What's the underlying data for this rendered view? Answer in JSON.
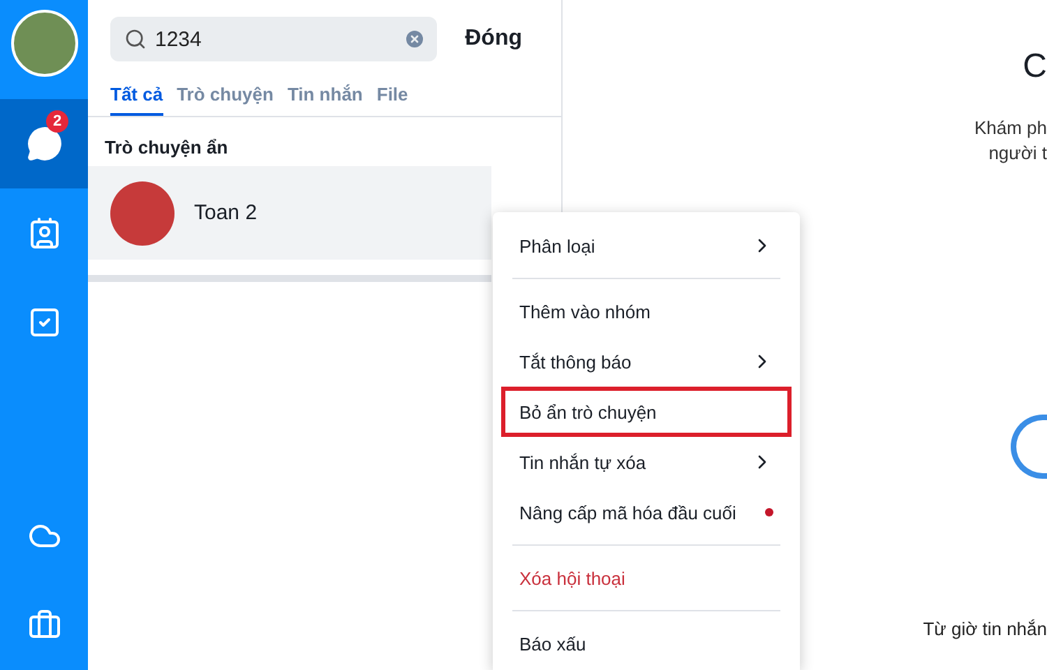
{
  "rail": {
    "top": [
      {
        "kind": "chat",
        "selected": true,
        "badge": "2"
      },
      {
        "kind": "contacts",
        "selected": false
      },
      {
        "kind": "todo",
        "selected": false
      }
    ],
    "bottom": [
      {
        "kind": "cloud",
        "selected": false
      },
      {
        "kind": "briefcase",
        "selected": false
      }
    ]
  },
  "search": {
    "value": "1234"
  },
  "close_button": "Đóng",
  "tabs": [
    {
      "label": "Tất cả",
      "selected": true
    },
    {
      "label": "Trò chuyện",
      "selected": false
    },
    {
      "label": "Tin nhắn",
      "selected": false
    },
    {
      "label": "File",
      "selected": false
    }
  ],
  "section_title": "Trò chuyện ẩn",
  "results": [
    {
      "name": "Toan 2",
      "selected": true
    }
  ],
  "context_menu": [
    [
      {
        "label": "Phân loại",
        "submenu": true,
        "dot": false,
        "danger": false,
        "highlighted": false
      }
    ],
    [
      {
        "label": "Thêm vào nhóm",
        "submenu": false,
        "dot": false,
        "danger": false,
        "highlighted": false
      },
      {
        "label": "Tắt thông báo",
        "submenu": true,
        "dot": false,
        "danger": false,
        "highlighted": false
      },
      {
        "label": "Bỏ ẩn trò chuyện",
        "submenu": false,
        "dot": false,
        "danger": false,
        "highlighted": true
      },
      {
        "label": "Tin nhắn tự xóa",
        "submenu": true,
        "dot": false,
        "danger": false,
        "highlighted": false
      },
      {
        "label": "Nâng cấp mã hóa đầu cuối",
        "submenu": false,
        "dot": true,
        "danger": false,
        "highlighted": false
      }
    ],
    [
      {
        "label": "Xóa hội thoại",
        "submenu": false,
        "dot": false,
        "danger": true,
        "highlighted": false
      }
    ],
    [
      {
        "label": "Báo xấu",
        "submenu": false,
        "dot": false,
        "danger": false,
        "highlighted": false
      }
    ]
  ],
  "welcome": {
    "title": "C",
    "lines": [
      "Khám ph",
      "người t"
    ],
    "footer": "Từ giờ tin nhắn"
  }
}
